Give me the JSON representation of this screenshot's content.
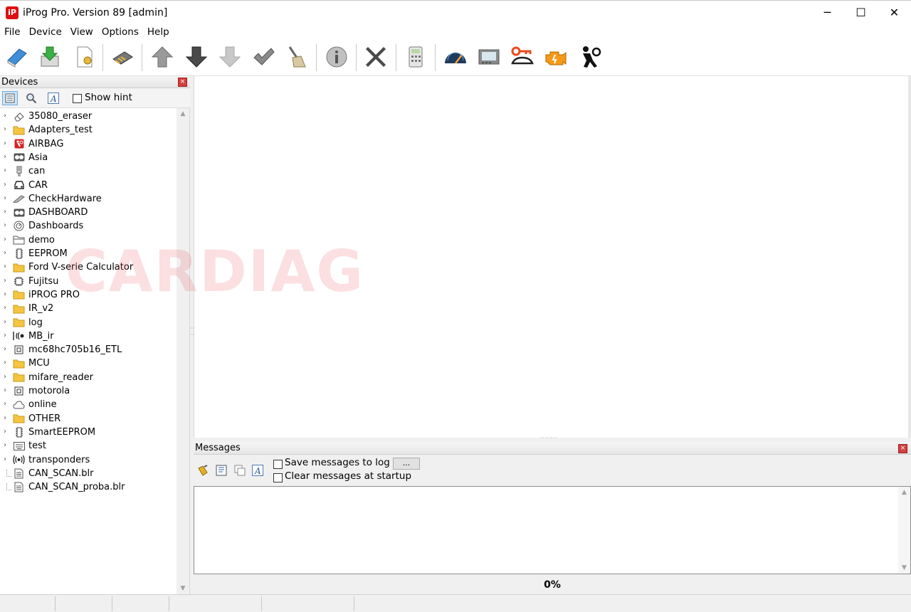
{
  "window": {
    "app_icon_text": "iP",
    "title": "iProg Pro. Version 89 [admin]",
    "controls": {
      "minimize": "─",
      "maximize": "☐",
      "close": "✕"
    }
  },
  "menu": [
    "File",
    "Device",
    "View",
    "Options",
    "Help"
  ],
  "toolbar_icons": [
    "open-book-icon",
    "download-icon",
    "document-settings-icon",
    "chip-icon",
    "arrow-up-icon",
    "arrow-down-icon",
    "arrow-down-disabled-icon",
    "check-icon",
    "broom-icon",
    "info-icon",
    "cross-icon",
    "calculator-icon",
    "speedometer-icon",
    "display-icon",
    "car-key-icon",
    "engine-icon",
    "airbag-person-icon"
  ],
  "devices": {
    "title": "Devices",
    "show_hint_label": "Show hint",
    "show_hint_checked": false,
    "items": [
      {
        "label": "35080_eraser",
        "icon": "eraser-icon",
        "arrow": "›"
      },
      {
        "label": "Adapters_test",
        "icon": "folder-icon",
        "arrow": "›"
      },
      {
        "label": "AIRBAG",
        "icon": "airbag-icon",
        "arrow": "›"
      },
      {
        "label": "Asia",
        "icon": "dashboard-cluster-icon",
        "arrow": "›"
      },
      {
        "label": "can",
        "icon": "connector-icon",
        "arrow": "›"
      },
      {
        "label": "CAR",
        "icon": "car-icon",
        "arrow": "›"
      },
      {
        "label": "CheckHardware",
        "icon": "probe-icon",
        "arrow": "›"
      },
      {
        "label": "DASHBOARD",
        "icon": "dashboard-cluster-icon",
        "arrow": "›"
      },
      {
        "label": "Dashboards",
        "icon": "gauge-icon",
        "arrow": "›"
      },
      {
        "label": "demo",
        "icon": "folder-outline-icon",
        "arrow": "›"
      },
      {
        "label": "EEPROM",
        "icon": "eeprom-chip-icon",
        "arrow": "›"
      },
      {
        "label": "Ford V-serie Calculator",
        "icon": "folder-icon",
        "arrow": "›"
      },
      {
        "label": "Fujitsu",
        "icon": "square-chip-icon",
        "arrow": "›"
      },
      {
        "label": "iPROG PRO",
        "icon": "folder-icon",
        "arrow": "›"
      },
      {
        "label": "IR_v2",
        "icon": "folder-icon",
        "arrow": "›"
      },
      {
        "label": "log",
        "icon": "folder-icon",
        "arrow": "›"
      },
      {
        "label": "MB_ir",
        "icon": "ir-signal-icon",
        "arrow": "›"
      },
      {
        "label": "mc68hc705b16_ETL",
        "icon": "mcu-chip-icon",
        "arrow": "›"
      },
      {
        "label": "MCU",
        "icon": "folder-icon",
        "arrow": "›"
      },
      {
        "label": "mifare_reader",
        "icon": "folder-icon",
        "arrow": "›"
      },
      {
        "label": "motorola",
        "icon": "mcu-chip-icon",
        "arrow": "›"
      },
      {
        "label": "online",
        "icon": "cloud-icon",
        "arrow": "›"
      },
      {
        "label": "OTHER",
        "icon": "folder-icon",
        "arrow": "›"
      },
      {
        "label": "SmartEEPROM",
        "icon": "eeprom-chip-icon",
        "arrow": "›"
      },
      {
        "label": "test",
        "icon": "keyboard-icon",
        "arrow": "›"
      },
      {
        "label": "transponders",
        "icon": "transponder-icon",
        "arrow": "›"
      },
      {
        "label": "CAN_SCAN.blr",
        "icon": "file-icon",
        "arrow": ""
      },
      {
        "label": "CAN_SCAN_proba.blr",
        "icon": "file-icon",
        "arrow": ""
      }
    ]
  },
  "watermark": "CARDIAG",
  "messages": {
    "title": "Messages",
    "save_log_label": "Save messages to log fi",
    "save_log_checked": false,
    "browse_label": "...",
    "clear_startup_label": "Clear messages at startup",
    "clear_startup_checked": false,
    "content": "",
    "progress_text": "0%",
    "progress_value": 0
  },
  "colors": {
    "accent_close": "#d34040",
    "selection": "#cde6f7",
    "folder": "#f5c542"
  }
}
